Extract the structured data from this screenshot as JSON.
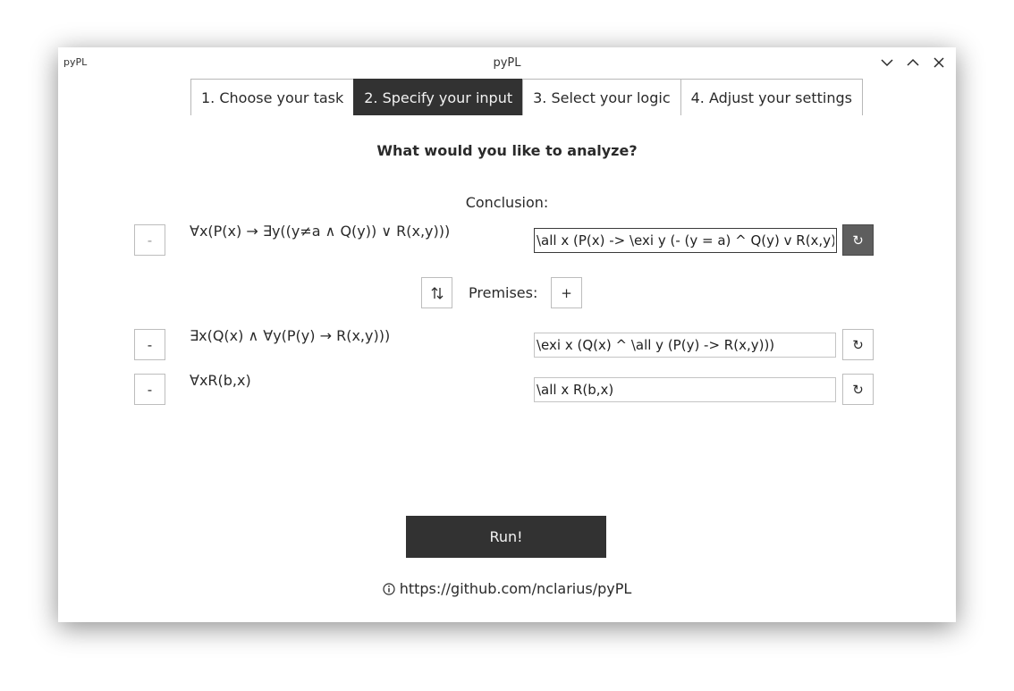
{
  "window": {
    "title": "pyPL",
    "app_name": "pyPL"
  },
  "tabs": [
    {
      "label": "1. Choose your task",
      "active": false
    },
    {
      "label": "2. Specify your input",
      "active": true
    },
    {
      "label": "3. Select your logic",
      "active": false
    },
    {
      "label": "4. Adjust your settings",
      "active": false
    }
  ],
  "main": {
    "heading": "What would you like to analyze?",
    "conclusion_label": "Conclusion:",
    "premises_label": "Premises:",
    "swap_icon": "swap-vertical-icon",
    "add_premise_label": "+",
    "run_label": "Run!"
  },
  "conclusion": {
    "remove_label": "-",
    "formula": "∀x(P(x) → ∃y((y≠a ∧ Q(y)) ∨ R(x,y)))",
    "input_value": "\\all x (P(x) -> \\exi y (- (y = a) ^ Q(y) v R(x,y)))",
    "reset_label": "↻"
  },
  "premises": [
    {
      "remove_label": "-",
      "formula": "∃x(Q(x) ∧ ∀y(P(y) → R(x,y)))",
      "input_value": "\\exi x (Q(x) ^ \\all y (P(y) -> R(x,y)))",
      "reset_label": "↻"
    },
    {
      "remove_label": "-",
      "formula": "∀xR(b,x)",
      "input_value": "\\all x R(b,x)",
      "reset_label": "↻"
    }
  ],
  "footer": {
    "icon": "info-icon",
    "link_text": "https://github.com/nclarius/pyPL"
  },
  "colors": {
    "dark": "#323232",
    "reset_active": "#5e5e5e",
    "border": "#bdbdbd"
  }
}
